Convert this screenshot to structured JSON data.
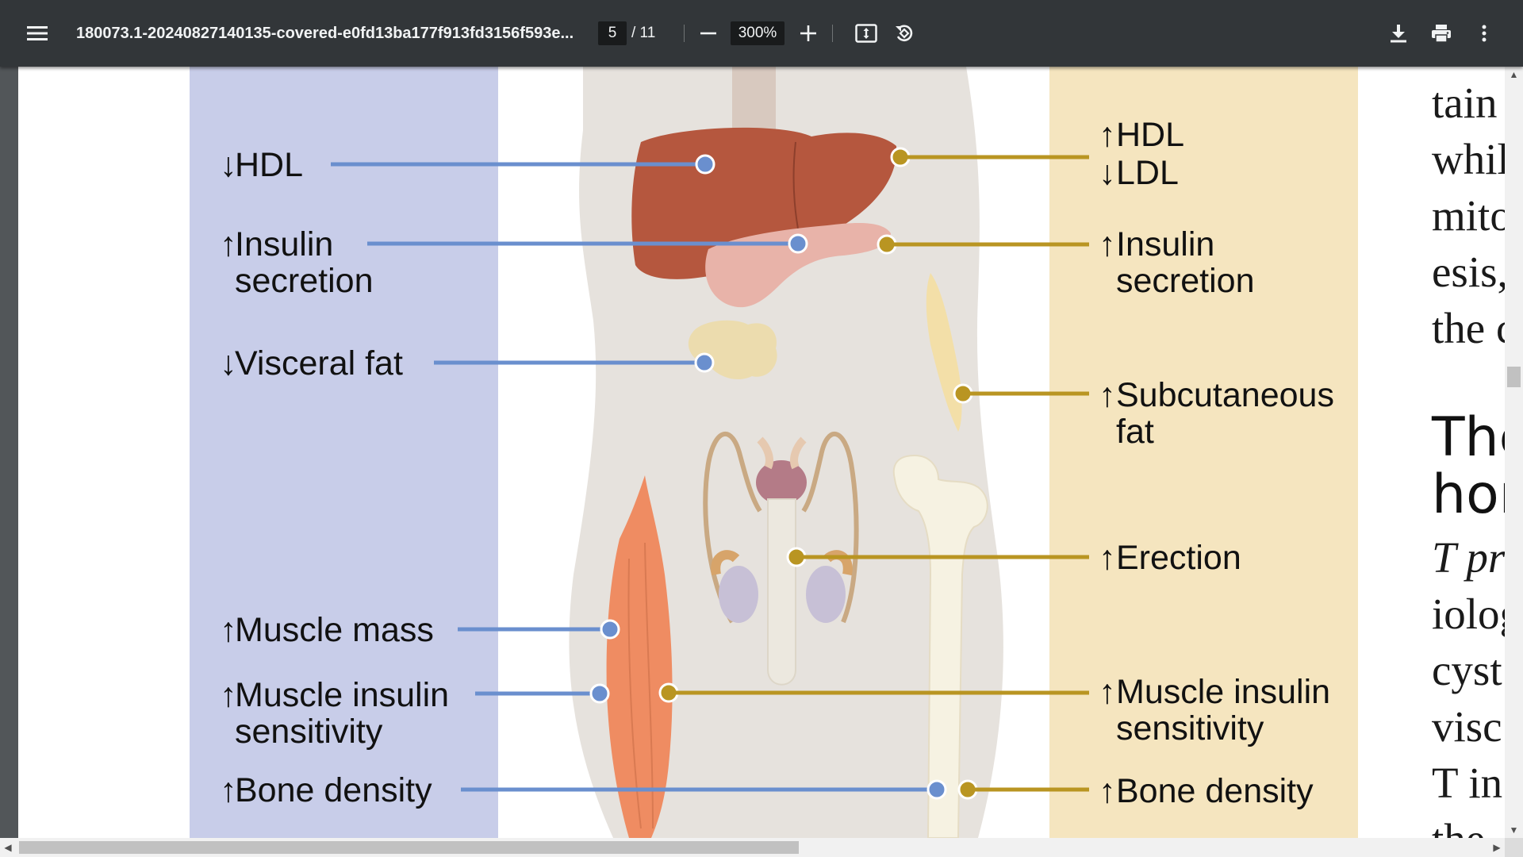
{
  "toolbar": {
    "menu_icon": "hamburger-menu-icon",
    "title": "180073.1-20240827140135-covered-e0fd13ba177f913fd3156f593e...",
    "page_current": "5",
    "page_total": "/ 11",
    "zoom": "300%",
    "icons": {
      "zoom_out": "minus-icon",
      "zoom_in": "plus-icon",
      "fit": "fit-to-page-icon",
      "rotate": "rotate-counterclockwise-icon",
      "download": "download-icon",
      "print": "print-icon",
      "more": "more-vertical-icon"
    }
  },
  "figure": {
    "colors": {
      "left_panel": "#c8cde9",
      "right_panel": "#f5e5bf",
      "body_bg": "#e6e2dd",
      "blue_line": "#6a8fce",
      "gold_line": "#b99522",
      "liver": "#b5573e",
      "muscle": "#ef8c62",
      "bone": "#f6f2e2"
    },
    "left_labels": [
      {
        "arrow": "↓",
        "lines": [
          "HDL"
        ]
      },
      {
        "arrow": "↑",
        "lines": [
          "Insulin",
          "secretion"
        ]
      },
      {
        "arrow": "↓",
        "lines": [
          "Visceral fat"
        ]
      },
      {
        "arrow": "↑",
        "lines": [
          "Muscle mass"
        ]
      },
      {
        "arrow": "↑",
        "lines": [
          "Muscle insulin",
          "sensitivity"
        ]
      },
      {
        "arrow": "↑",
        "lines": [
          "Bone density"
        ]
      }
    ],
    "right_labels": [
      {
        "arrows": [
          "↑",
          "↓"
        ],
        "lines": [
          "HDL",
          "LDL"
        ]
      },
      {
        "arrows": [
          "↑"
        ],
        "lines": [
          "Insulin",
          "secretion"
        ]
      },
      {
        "arrows": [
          "↑"
        ],
        "lines": [
          "Subcutaneous",
          "fat"
        ]
      },
      {
        "arrows": [
          "↑"
        ],
        "lines": [
          "Erection"
        ]
      },
      {
        "arrows": [
          "↑"
        ],
        "lines": [
          "Muscle insulin",
          "sensitivity"
        ]
      },
      {
        "arrows": [
          "↑"
        ],
        "lines": [
          "Bone density"
        ]
      }
    ]
  },
  "body_text": {
    "lines_top": [
      "tain",
      "whil",
      "mito",
      "esis,",
      "the c"
    ],
    "heading": [
      "The",
      "hor"
    ],
    "italic_line": "T pr",
    "lines_bottom": [
      "iolog",
      "cyst",
      "visc",
      "T in",
      "the"
    ]
  },
  "scrollbars": {
    "up_arrow": "▲",
    "down_arrow": "▼",
    "left_arrow": "◀",
    "right_arrow": "▶"
  }
}
